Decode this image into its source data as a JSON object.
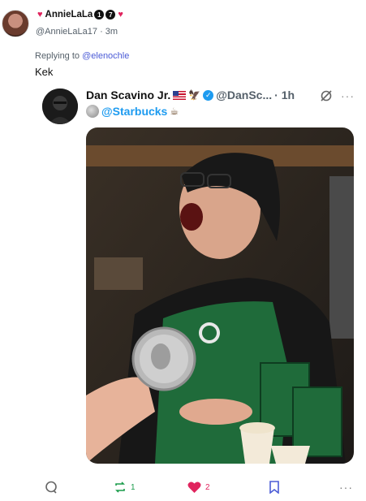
{
  "post": {
    "author_name": "AnnieLaLa",
    "badge_1": "1",
    "badge_2": "7",
    "handle": "@AnnieLaLa17",
    "time_sep": " · ",
    "time": "3m",
    "replying_prefix": "Replying to ",
    "replying_to": "@elenochle",
    "text": "Kek"
  },
  "quoted": {
    "author_name": "Dan Scavino Jr.",
    "handle": "@DanSc...",
    "time": "· 1h",
    "mention": "@Starbucks",
    "more": "···"
  },
  "actions": {
    "reply_count": "",
    "repost_count": "1",
    "like_count": "2",
    "more": "···"
  },
  "colors": {
    "accent_blue": "#1d9bf0",
    "mention_purple": "#4b5bd6",
    "like_pink": "#e0245e",
    "repost_green": "#1a9c4a",
    "starbucks_green": "#1f6b3a"
  },
  "icons": [
    "heart-icon",
    "verified-icon",
    "eagle-icon",
    "flag-icon",
    "moon-icon",
    "coffee-icon",
    "no-reply-icon",
    "more-icon",
    "reply-icon",
    "repost-icon",
    "bookmark-icon"
  ]
}
